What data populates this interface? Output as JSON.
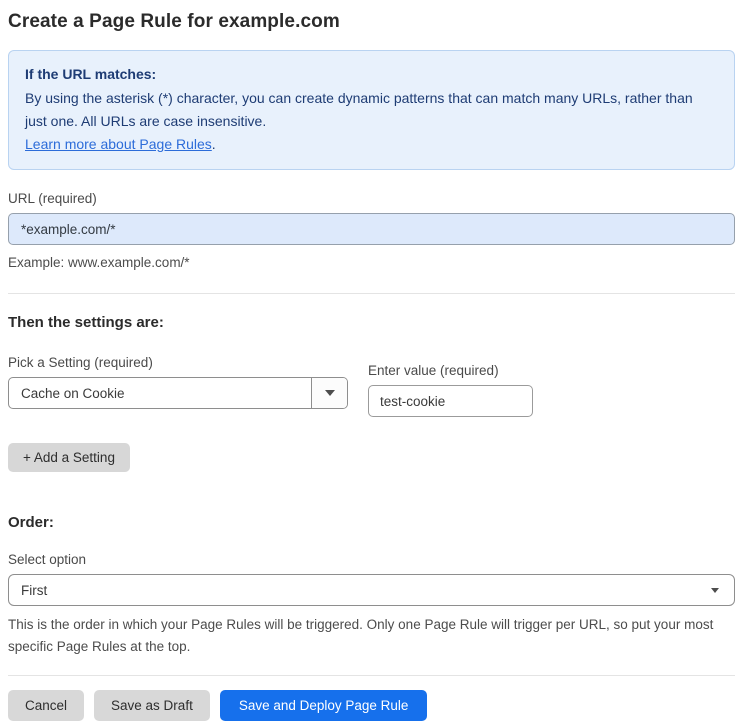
{
  "page": {
    "title": "Create a Page Rule for example.com"
  },
  "info_box": {
    "heading": "If the URL matches:",
    "body": "By using the asterisk (*) character, you can create dynamic patterns that can match many URLs, rather than just one. All URLs are case insensitive.",
    "link_label": "Learn more about Page Rules",
    "link_suffix": "."
  },
  "url_field": {
    "label": "URL (required)",
    "value": "*example.com/*",
    "helper": "Example: www.example.com/*"
  },
  "settings_section": {
    "heading": "Then the settings are:",
    "setting_select": {
      "label": "Pick a Setting (required)",
      "selected_value": "Cache on Cookie"
    },
    "value_field": {
      "label": "Enter value (required)",
      "value": "test-cookie"
    },
    "add_setting_label": "+ Add a Setting"
  },
  "order_section": {
    "heading": "Order:",
    "select_label": "Select option",
    "selected_option": "First",
    "helper": "This is the order in which your Page Rules will be triggered. Only one Page Rule will trigger per URL, so put your most specific Page Rules at the top."
  },
  "footer": {
    "cancel_label": "Cancel",
    "save_draft_label": "Save as Draft",
    "save_deploy_label": "Save and Deploy Page Rule"
  },
  "icons": {
    "setting_dropdown": "chevron-down-icon",
    "order_dropdown": "chevron-down-icon"
  },
  "colors": {
    "accent_blue": "#1670ec",
    "info_box_bg": "#e8f1fc",
    "info_box_border": "#b9d3f1",
    "info_box_text": "#1e3c74",
    "link_blue": "#2c6cd9",
    "url_input_bg": "#dde9fb",
    "gray_button_bg": "#d8d8d8"
  }
}
